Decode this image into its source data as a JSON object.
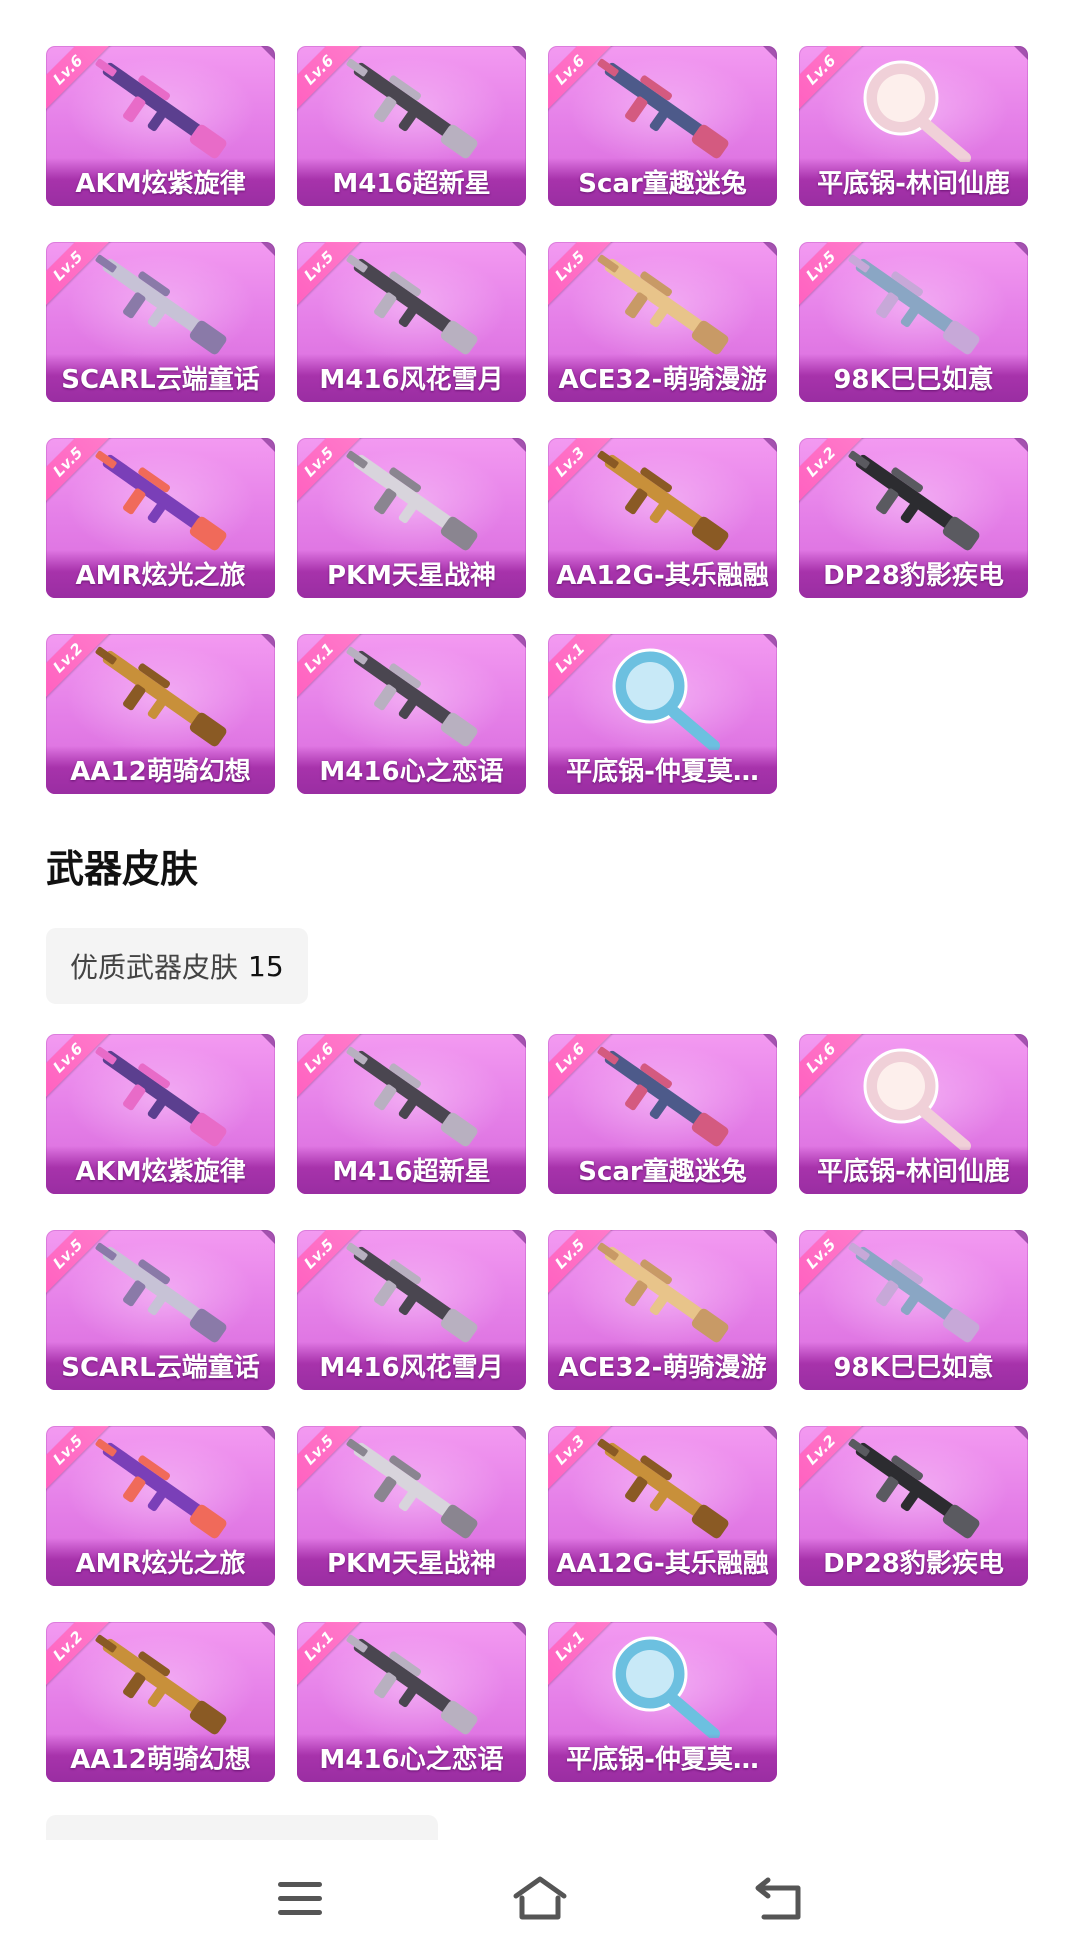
{
  "skins_top": [
    {
      "level": "Lv.6",
      "name": "AKM炫紫旋律",
      "icon": "akm-rifle-icon"
    },
    {
      "level": "Lv.6",
      "name": "M416超新星",
      "icon": "m416-rifle-icon"
    },
    {
      "level": "Lv.6",
      "name": "Scar童趣迷兔",
      "icon": "scar-rifle-icon"
    },
    {
      "level": "Lv.6",
      "name": "平底锅-林间仙鹿",
      "icon": "pan-mirror-icon"
    },
    {
      "level": "Lv.5",
      "name": "SCARL云端童话",
      "icon": "scarl-rifle-icon"
    },
    {
      "level": "Lv.5",
      "name": "M416风花雪月",
      "icon": "m416-rifle-icon"
    },
    {
      "level": "Lv.5",
      "name": "ACE32-萌骑漫游",
      "icon": "ace32-rifle-icon"
    },
    {
      "level": "Lv.5",
      "name": "98K巳巳如意",
      "icon": "98k-sniper-icon"
    },
    {
      "level": "Lv.5",
      "name": "AMR炫光之旅",
      "icon": "amr-sniper-icon"
    },
    {
      "level": "Lv.5",
      "name": "PKM天星战神",
      "icon": "pkm-machinegun-icon"
    },
    {
      "level": "Lv.3",
      "name": "AA12G-其乐融融",
      "icon": "aa12-shotgun-icon"
    },
    {
      "level": "Lv.2",
      "name": "DP28豹影疾电",
      "icon": "dp28-machinegun-icon"
    },
    {
      "level": "Lv.2",
      "name": "AA12萌骑幻想",
      "icon": "aa12-shotgun-icon"
    },
    {
      "level": "Lv.1",
      "name": "M416心之恋语",
      "icon": "m416-rifle-icon"
    },
    {
      "level": "Lv.1",
      "name": "平底锅-仲夏莫…",
      "icon": "pan-icon"
    }
  ],
  "section": {
    "title": "武器皮肤",
    "filter_label": "优质武器皮肤",
    "filter_count": "15"
  },
  "skins_bottom": [
    {
      "level": "Lv.6",
      "name": "AKM炫紫旋律",
      "icon": "akm-rifle-icon"
    },
    {
      "level": "Lv.6",
      "name": "M416超新星",
      "icon": "m416-rifle-icon"
    },
    {
      "level": "Lv.6",
      "name": "Scar童趣迷兔",
      "icon": "scar-rifle-icon"
    },
    {
      "level": "Lv.6",
      "name": "平底锅-林间仙鹿",
      "icon": "pan-mirror-icon"
    },
    {
      "level": "Lv.5",
      "name": "SCARL云端童话",
      "icon": "scarl-rifle-icon"
    },
    {
      "level": "Lv.5",
      "name": "M416风花雪月",
      "icon": "m416-rifle-icon"
    },
    {
      "level": "Lv.5",
      "name": "ACE32-萌骑漫游",
      "icon": "ace32-rifle-icon"
    },
    {
      "level": "Lv.5",
      "name": "98K巳巳如意",
      "icon": "98k-sniper-icon"
    },
    {
      "level": "Lv.5",
      "name": "AMR炫光之旅",
      "icon": "amr-sniper-icon"
    },
    {
      "level": "Lv.5",
      "name": "PKM天星战神",
      "icon": "pkm-machinegun-icon"
    },
    {
      "level": "Lv.3",
      "name": "AA12G-其乐融融",
      "icon": "aa12-shotgun-icon"
    },
    {
      "level": "Lv.2",
      "name": "DP28豹影疾电",
      "icon": "dp28-machinegun-icon"
    },
    {
      "level": "Lv.2",
      "name": "AA12萌骑幻想",
      "icon": "aa12-shotgun-icon"
    },
    {
      "level": "Lv.1",
      "name": "M416心之恋语",
      "icon": "m416-rifle-icon"
    },
    {
      "level": "Lv.1",
      "name": "平底锅-仲夏莫…",
      "icon": "pan-icon"
    }
  ],
  "nav": {
    "menu_icon": "menu-icon",
    "home_icon": "home-icon",
    "back_icon": "back-icon"
  },
  "colors": {
    "card_top": "#f39af1",
    "card_bottom": "#d86adc",
    "label_band": "#9a2ea2",
    "level_ribbon": "#ff5fbf",
    "chip_bg": "#f4f4f4",
    "nav_icon": "#555555"
  }
}
